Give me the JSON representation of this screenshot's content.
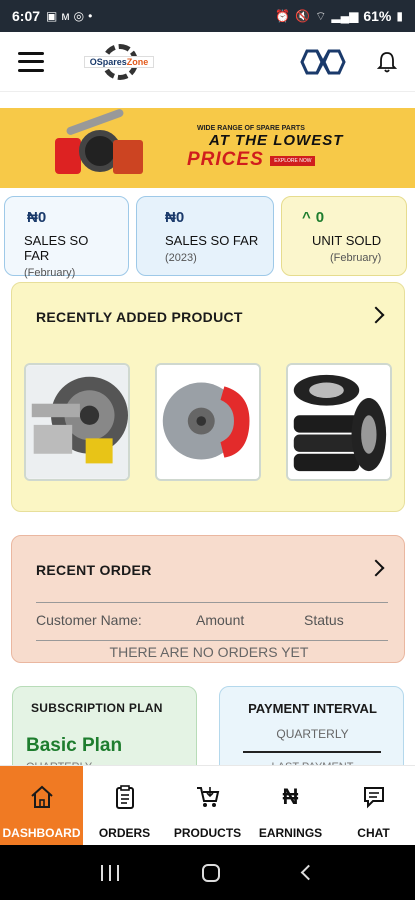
{
  "status_bar": {
    "time": "6:07",
    "battery": "61%"
  },
  "header": {
    "logo_text_1": "OSpares",
    "logo_text_2": "Zone"
  },
  "banner": {
    "small_text": "WIDE RANGE OF SPARE PARTS",
    "line1": "AT THE LOWEST",
    "line2": "PRICES",
    "tag": "EXPLORE NOW"
  },
  "stats": [
    {
      "value": "₦0",
      "label": "SALES SO FAR",
      "sub": "(February)"
    },
    {
      "value": "₦0",
      "label": "SALES SO FAR",
      "sub": "(2023)"
    },
    {
      "value": "0",
      "label": "UNIT SOLD",
      "sub": "(February)"
    }
  ],
  "recently_added": {
    "title": "RECENTLY ADDED PRODUCT"
  },
  "recent_order": {
    "title": "RECENT ORDER",
    "columns": [
      "Customer Name:",
      "Amount",
      "Status"
    ],
    "empty_message": "THERE ARE NO ORDERS YET"
  },
  "subscription": {
    "title": "SUBSCRIPTION PLAN",
    "plan": "Basic Plan",
    "interval_label": "QUARTERLY"
  },
  "payment_interval": {
    "title": "PAYMENT INTERVAL",
    "value": "QUARTERLY",
    "last_payment": "LAST PAYMENT"
  },
  "bottom_nav": [
    {
      "label": "DASHBOARD",
      "icon": "home-icon"
    },
    {
      "label": "ORDERS",
      "icon": "clipboard-icon"
    },
    {
      "label": "PRODUCTS",
      "icon": "cart-icon"
    },
    {
      "label": "EARNINGS",
      "icon": "naira-icon"
    },
    {
      "label": "CHAT",
      "icon": "chat-icon"
    }
  ],
  "colors": {
    "accent": "#f07a23",
    "banner": "#f7c948",
    "green": "#1e7d2e",
    "navy": "#1a3a6b"
  }
}
